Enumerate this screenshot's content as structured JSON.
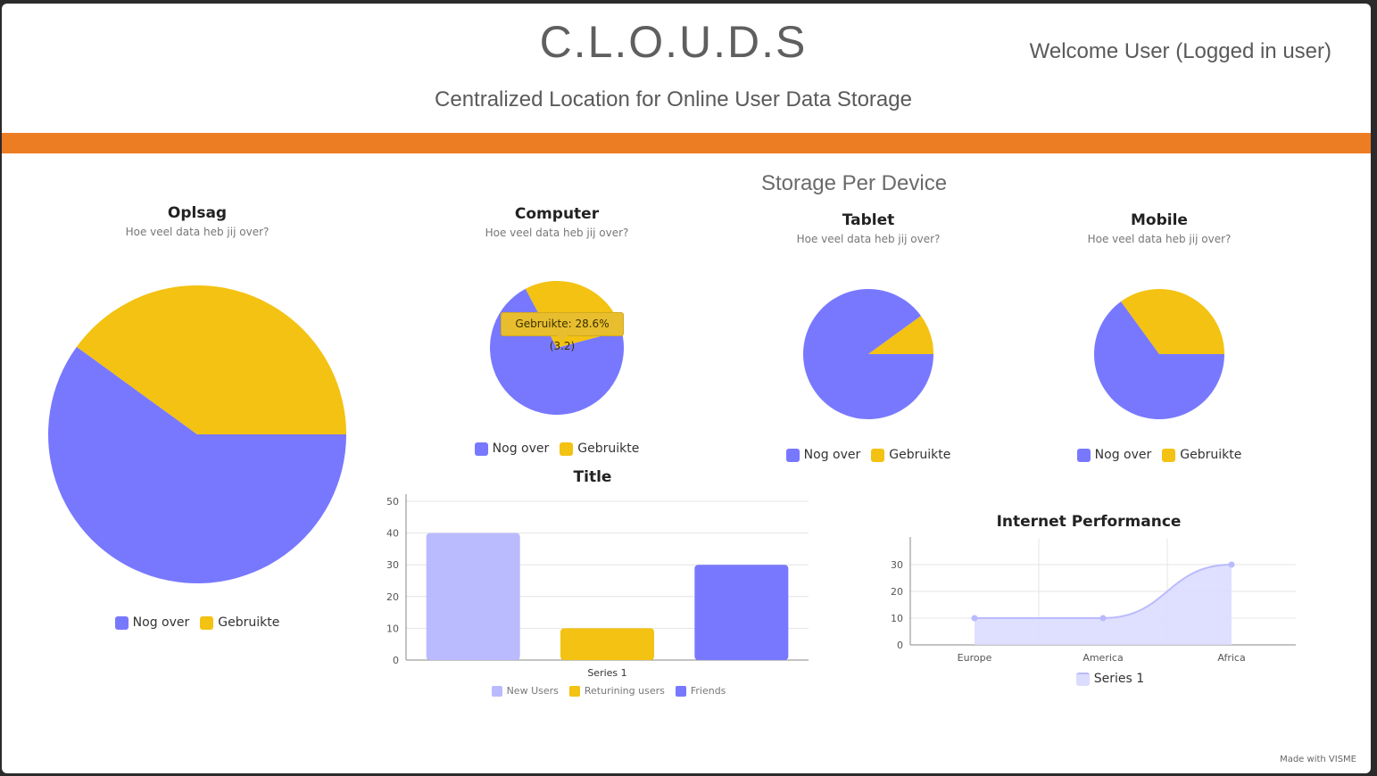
{
  "header": {
    "title": "C.L.O.U.D.S",
    "welcome": "Welcome User (Logged in user)",
    "subtitle": "Centralized Location for Online User Data Storage"
  },
  "section_title": "Storage Per Device",
  "colors": {
    "accent_band": "#ed7d22",
    "nog_over": "#7878ff",
    "gebruikte": "#f3c212",
    "new_users": "#babaff"
  },
  "pies": [
    {
      "id": "opslag",
      "title": "Oplsag",
      "subtitle": "Hoe veel data heb jij over?",
      "legend": [
        "Nog over",
        "Gebruikte"
      ]
    },
    {
      "id": "computer",
      "title": "Computer",
      "subtitle": "Hoe veel data heb jij over?",
      "legend": [
        "Nog over",
        "Gebruikte"
      ],
      "tooltip": "Gebruikte: 28.6% (3.2)"
    },
    {
      "id": "tablet",
      "title": "Tablet",
      "subtitle": "Hoe veel data heb jij over?",
      "legend": [
        "Nog over",
        "Gebruikte"
      ]
    },
    {
      "id": "mobile",
      "title": "Mobile",
      "subtitle": "Hoe veel data heb jij over?",
      "legend": [
        "Nog over",
        "Gebruikte"
      ]
    }
  ],
  "bar": {
    "title": "Title",
    "legend": [
      "New Users",
      "Returining users",
      "Friends"
    ]
  },
  "line": {
    "title": "Internet Performance",
    "legend": [
      "Series 1"
    ]
  },
  "footer": {
    "made_with": "Made with VISME"
  },
  "chart_data": [
    {
      "type": "pie",
      "title": "Oplsag",
      "labels": [
        "Nog over",
        "Gebruikte"
      ],
      "values": [
        60,
        40
      ],
      "colors": [
        "#7878ff",
        "#f3c212"
      ]
    },
    {
      "type": "pie",
      "title": "Computer",
      "labels": [
        "Nog over",
        "Gebruikte"
      ],
      "values": [
        71.4,
        28.6
      ],
      "colors": [
        "#7878ff",
        "#f3c212"
      ]
    },
    {
      "type": "pie",
      "title": "Tablet",
      "labels": [
        "Nog over",
        "Gebruikte"
      ],
      "values": [
        90,
        10
      ],
      "colors": [
        "#7878ff",
        "#f3c212"
      ]
    },
    {
      "type": "pie",
      "title": "Mobile",
      "labels": [
        "Nog over",
        "Gebruikte"
      ],
      "values": [
        65,
        35
      ],
      "colors": [
        "#7878ff",
        "#f3c212"
      ]
    },
    {
      "type": "bar",
      "title": "Title",
      "categories": [
        "Series 1"
      ],
      "series": [
        {
          "name": "New Users",
          "values": [
            40
          ],
          "color": "#babaff"
        },
        {
          "name": "Returining users",
          "values": [
            10
          ],
          "color": "#f3c212"
        },
        {
          "name": "Friends",
          "values": [
            30
          ],
          "color": "#7878ff"
        }
      ],
      "ylim": [
        0,
        50
      ],
      "yticks": [
        0,
        10,
        20,
        30,
        40,
        50
      ],
      "grid": true,
      "legend": "bottom"
    },
    {
      "type": "area",
      "title": "Internet Performance",
      "x": [
        "Europe",
        "America",
        "Africa"
      ],
      "series": [
        {
          "name": "Series 1",
          "values": [
            10,
            10,
            30
          ],
          "color": "#babaff"
        }
      ],
      "ylim": [
        0,
        30
      ],
      "yticks": [
        0,
        10,
        20,
        30
      ],
      "grid": true,
      "legend": "bottom"
    }
  ]
}
